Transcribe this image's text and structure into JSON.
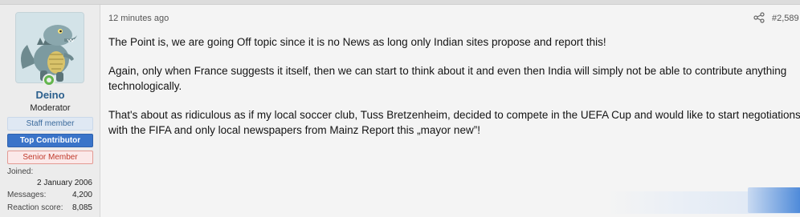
{
  "user": {
    "name": "Deino",
    "title": "Moderator",
    "banners": {
      "staff": "Staff member",
      "top_contributor": "Top Contributor",
      "senior": "Senior Member"
    },
    "stats": {
      "joined_label": "Joined:",
      "joined_value": "2 January 2006",
      "messages_label": "Messages:",
      "messages_value": "4,200",
      "reaction_label": "Reaction score:",
      "reaction_value": "8,085"
    },
    "avatar_icon": "dinosaur-avatar",
    "online_icon": "online-status-icon"
  },
  "post": {
    "time": "12 minutes ago",
    "number": "#2,589",
    "share_icon": "share-icon",
    "paragraphs": [
      "The Point is, we are going Off topic since it is no News as long only Indian sites propose and report this!",
      "Again, only when France suggests it itself, then we can start to think about it and even then India will simply not be able to contribute anything technologically.",
      "That's about as ridiculous as if my local soccer club, Tuss Bretzenheim, decided to compete in the UEFA Cup and would like to start negotiations with the FIFA and only local newspapers from Mainz Report this „mayor new”!"
    ]
  },
  "colors": {
    "username": "#2b5f8d",
    "top_contributor_bg": "#3a74c9",
    "senior_text": "#c0392b",
    "online": "#63b64e"
  }
}
